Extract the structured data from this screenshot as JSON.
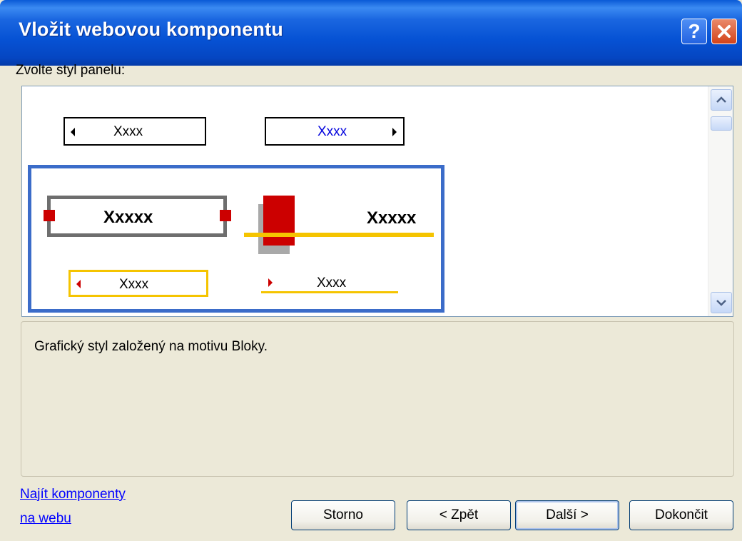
{
  "window": {
    "title": "Vložit webovou komponentu"
  },
  "title_buttons": {
    "help_glyph": "?"
  },
  "panel_style": {
    "label": "Zvolte styl panelu:",
    "samples": {
      "top_left": "Xxxx",
      "top_right": "Xxxx",
      "selected_big_left": "Xxxxx",
      "selected_big_right": "Xxxxx",
      "selected_small_left": "Xxxx",
      "selected_small_right": "Xxxx"
    }
  },
  "description": "Grafický styl založený na motivu Bloky.",
  "links": {
    "line1": "Najít komponenty",
    "line2": "na webu"
  },
  "buttons": {
    "cancel": "Storno",
    "back": "< Zpět",
    "next": "Další >",
    "finish": "Dokončit"
  },
  "colors": {
    "title_bar": "#0a5ad6",
    "selection": "#3b6cc9",
    "accent_red": "#cc0000",
    "accent_yellow": "#f5c400"
  }
}
